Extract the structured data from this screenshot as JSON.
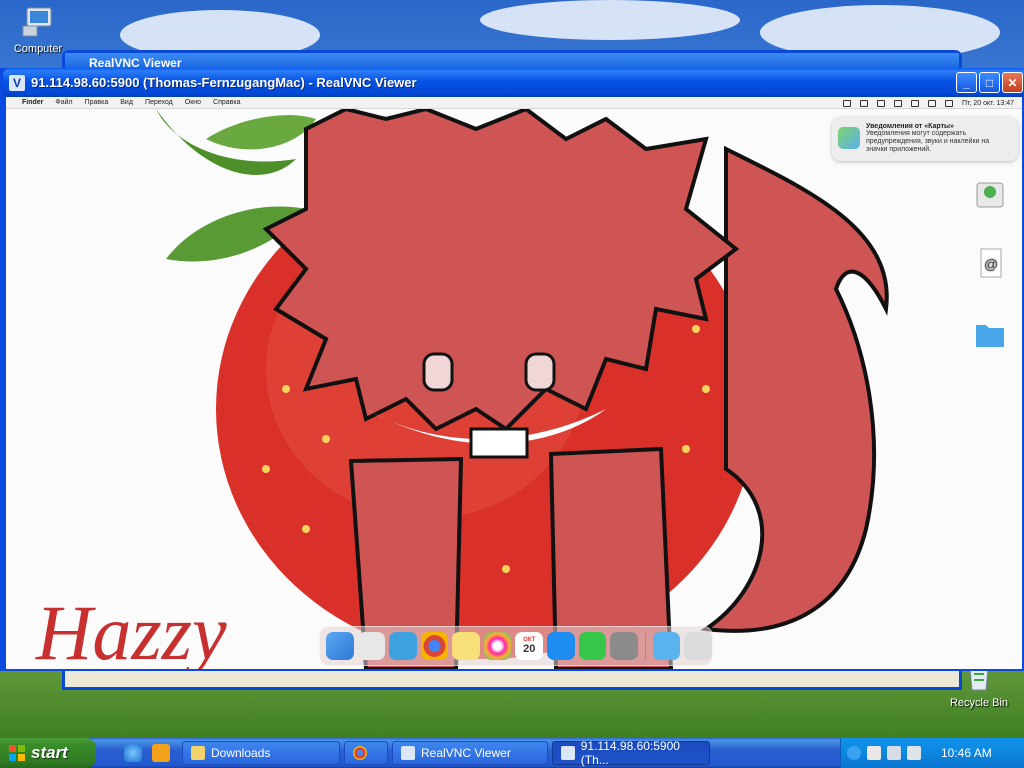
{
  "desktop": {
    "icons": [
      {
        "label": "Computer"
      },
      {
        "label": "Recycle Bin"
      }
    ]
  },
  "background_window": {
    "title": "RealVNC Viewer"
  },
  "vnc_window": {
    "title": "91.114.98.60:5900 (Thomas-FernzugangMac) - RealVNC Viewer",
    "buttons": {
      "minimize": "_",
      "maximize": "□",
      "close": "✕"
    }
  },
  "mac": {
    "menubar": {
      "items": [
        "Finder",
        "Файл",
        "Правка",
        "Вид",
        "Переход",
        "Окно",
        "Справка"
      ],
      "datetime": "Пт, 20 окт.  13:47"
    },
    "notification": {
      "title": "Уведомления от «Карты»",
      "text": "Уведомления могут содержать предупреждения, звуки и наклейки на значки приложений."
    },
    "artwork": {
      "signature": "Hazzy"
    },
    "dock": {
      "calendar_month": "ОКТ",
      "calendar_day": "20"
    }
  },
  "taskbar": {
    "start_label": "start",
    "tasks": [
      {
        "label": "Downloads"
      },
      {
        "label": ""
      },
      {
        "label": "RealVNC Viewer"
      },
      {
        "label": "91.114.98.60:5900 (Th..."
      }
    ],
    "clock": "10:46 AM"
  },
  "colors": {
    "xp_blue": "#245ad0",
    "start_green": "#3b8d2b",
    "fur_red": "#cf5555",
    "strawberry": "#d9302a"
  }
}
